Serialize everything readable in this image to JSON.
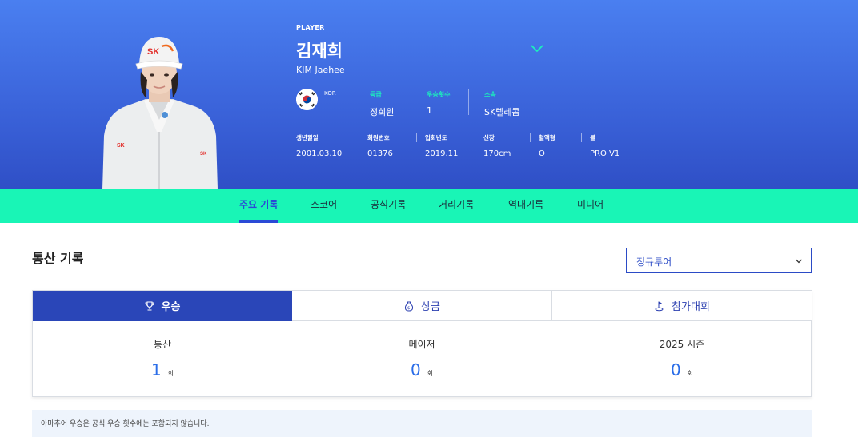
{
  "hero": {
    "label": "PLAYER",
    "name_kr": "김재희",
    "name_en": "KIM Jaehee",
    "country": "KOR",
    "info": [
      {
        "key": "등급",
        "value": "정회원"
      },
      {
        "key": "우승횟수",
        "value": "1"
      },
      {
        "key": "소속",
        "value": "SK텔레콤"
      }
    ],
    "meta": [
      {
        "key": "생년월일",
        "value": "2001.03.10"
      },
      {
        "key": "회원번호",
        "value": "01376"
      },
      {
        "key": "입회년도",
        "value": "2019.11"
      },
      {
        "key": "신장",
        "value": "170cm"
      },
      {
        "key": "혈액형",
        "value": "O"
      },
      {
        "key": "볼",
        "value": "PRO V1"
      }
    ],
    "cap_logo": "SK",
    "accent_color": "#1cf0bd",
    "icons": [
      "chevron-down-icon",
      "korea-flag-icon"
    ]
  },
  "tabs": [
    {
      "label": "주요 기록",
      "active": true
    },
    {
      "label": "스코어",
      "active": false
    },
    {
      "label": "공식기록",
      "active": false
    },
    {
      "label": "거리기록",
      "active": false
    },
    {
      "label": "역대기록",
      "active": false
    },
    {
      "label": "미디어",
      "active": false
    }
  ],
  "section": {
    "title": "통산 기록",
    "select_value": "정규투어"
  },
  "card": {
    "tabs": [
      {
        "label": "우승",
        "icon": "trophy-icon",
        "active": true
      },
      {
        "label": "상금",
        "icon": "money-bag-icon",
        "active": false
      },
      {
        "label": "참가대회",
        "icon": "golf-flag-icon",
        "active": false
      }
    ],
    "stats": [
      {
        "label": "통산",
        "value": "1",
        "unit": "회"
      },
      {
        "label": "메이저",
        "value": "0",
        "unit": "회"
      },
      {
        "label": "2025 시즌",
        "value": "0",
        "unit": "회"
      }
    ]
  },
  "notice": "아마추어 우승은 공식 우승 횟수에는 포함되지 않습니다.",
  "colors": {
    "hero_gradient_top": "#4a7ff0",
    "hero_gradient_bottom": "#2f4fc6",
    "tabbar": "#19f5b6",
    "primary": "#2a46b8",
    "value_blue": "#2a6de8"
  }
}
